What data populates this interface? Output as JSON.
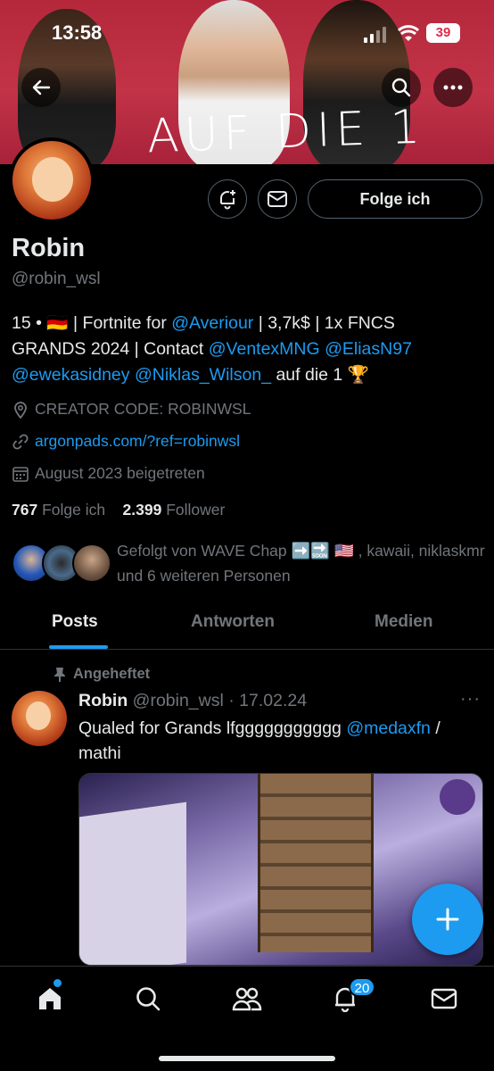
{
  "status_bar": {
    "time": "13:58",
    "battery": "39"
  },
  "banner": {
    "text": "AUF DIE 1"
  },
  "profile": {
    "name": "Robin",
    "handle": "@robin_wsl",
    "follow_button": "Folge ich",
    "bio": {
      "line1_pre": "15 • 🇩🇪 | Fortnite for ",
      "mention_averiour": "@Averiour",
      "line1_post": " | 3,7k$ | 1x FNCS",
      "line2_pre": "GRANDS 2024 | Contact ",
      "mention_vantex": "@VentexMNG",
      "mention_elias": "@EliasN97",
      "mention_eweka": "@ewekasidney",
      "mention_niklas": "@Niklas_Wilson_",
      "line3_post": " auf die 1 🏆"
    },
    "location": "CREATOR CODE: ROBINWSL",
    "website": "argonpads.com/?ref=robinwsl",
    "joined": "August 2023 beigetreten",
    "following_count": "767",
    "following_label": "Folge ich",
    "followers_count": "2.399",
    "followers_label": "Follower",
    "followed_by": "Gefolgt von WAVE Chap ➡️🔜 🇺🇸 , kawaii, niklaskmr und 6 weiteren Personen"
  },
  "tabs": [
    {
      "label": "Posts",
      "active": true
    },
    {
      "label": "Antworten",
      "active": false
    },
    {
      "label": "Medien",
      "active": false
    }
  ],
  "post": {
    "pinned_label": "Angeheftet",
    "author": "Robin",
    "handle_date": "@robin_wsl · 17.02.24",
    "more": "···",
    "text_pre": "Qualed for Grands lfggggggggggg ",
    "mention": "@medaxfn",
    "text_post": " / mathi"
  },
  "bottom_nav": {
    "notifications_badge": "20"
  },
  "colors": {
    "accent": "#1d9bf0",
    "background": "#000000",
    "muted": "#71767b",
    "text": "#e7e9ea"
  }
}
